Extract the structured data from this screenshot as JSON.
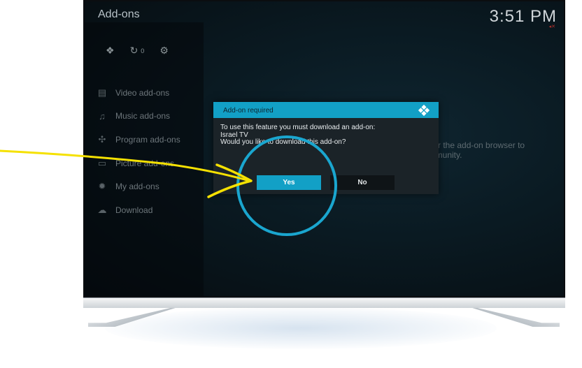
{
  "window": {
    "title": "Add-ons",
    "clock": "3:51 PM",
    "indicator": "◂✕"
  },
  "toolbar": {
    "items": [
      {
        "icon": "dropbox-icon",
        "glyph": "❖"
      },
      {
        "icon": "refresh-icon",
        "glyph": "↻"
      },
      {
        "icon": "gear-icon",
        "glyph": "⚙"
      }
    ],
    "refresh_count": "0"
  },
  "sidebar": {
    "items": [
      {
        "label": "Video add-ons",
        "icon": "film-icon",
        "glyph": "▤"
      },
      {
        "label": "Music add-ons",
        "icon": "headphones-icon",
        "glyph": "♫"
      },
      {
        "label": "Program add-ons",
        "icon": "puzzle-icon",
        "glyph": "✣"
      },
      {
        "label": "Picture add-ons",
        "icon": "picture-icon",
        "glyph": "▭"
      },
      {
        "label": "My add-ons",
        "icon": "gear-icon",
        "glyph": "✹"
      },
      {
        "label": "Download",
        "icon": "cloud-download-icon",
        "glyph": "☁"
      }
    ]
  },
  "background_hint": {
    "line1": "ter the add-on browser to",
    "line2": "nmunity."
  },
  "dialog": {
    "title": "Add-on required",
    "line1": "To use this feature you must download an add-on:",
    "line2": "Israel TV",
    "line3": "Would you like to download this add-on?",
    "yes_label": "Yes",
    "no_label": "No"
  },
  "annotations": {
    "arrow_color": "#f5e102",
    "circle_color": "#1aa6cf"
  },
  "colors": {
    "accent": "#12a0c6",
    "dialog_bg": "#1b2328"
  }
}
